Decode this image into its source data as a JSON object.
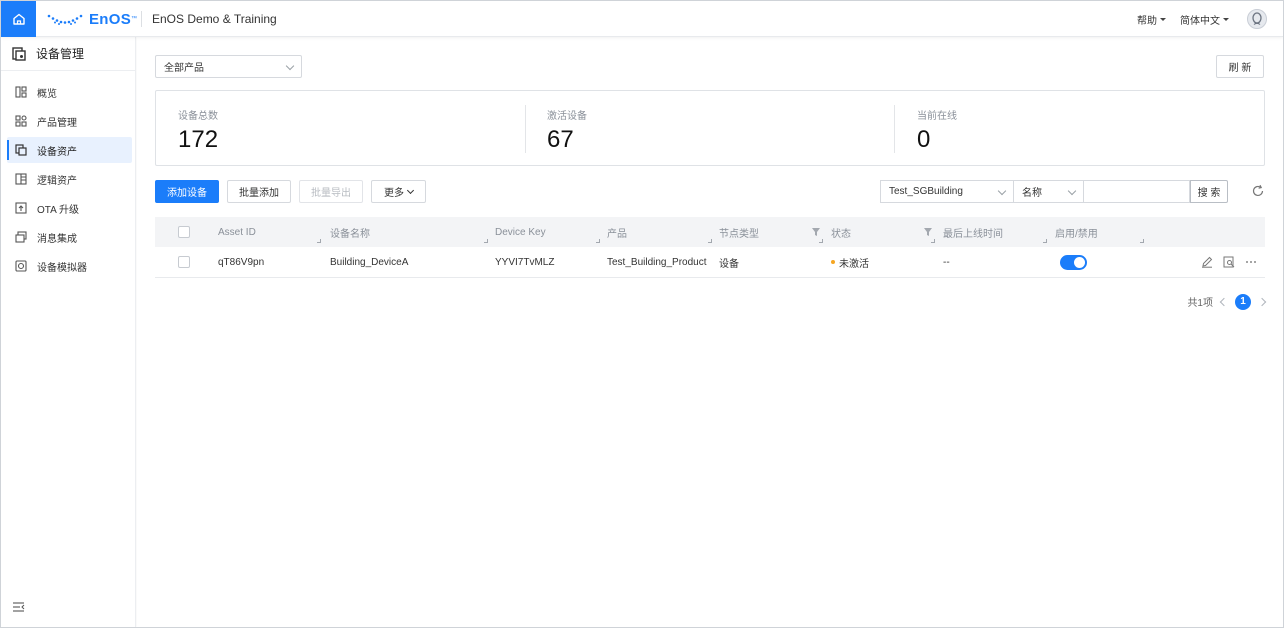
{
  "header": {
    "logo_text": "EnOS",
    "logo_tm": "™",
    "org_name": "EnOS Demo & Training",
    "help_label": "帮助",
    "language_label": "简体中文"
  },
  "sidebar": {
    "title": "设备管理",
    "items": [
      {
        "label": "概览",
        "icon": "dashboard-icon",
        "active": false
      },
      {
        "label": "产品管理",
        "icon": "product-grid-icon",
        "active": false
      },
      {
        "label": "设备资产",
        "icon": "device-asset-icon",
        "active": true
      },
      {
        "label": "逻辑资产",
        "icon": "logical-asset-icon",
        "active": false
      },
      {
        "label": "OTA 升级",
        "icon": "ota-upgrade-icon",
        "active": false
      },
      {
        "label": "消息集成",
        "icon": "message-integration-icon",
        "active": false
      },
      {
        "label": "设备模拟器",
        "icon": "device-simulator-icon",
        "active": false
      }
    ]
  },
  "filters": {
    "product_select": "全部产品",
    "refresh_label": "刷 新"
  },
  "stats": [
    {
      "label": "设备总数",
      "value": "172"
    },
    {
      "label": "激活设备",
      "value": "67"
    },
    {
      "label": "当前在线",
      "value": "0"
    }
  ],
  "toolbar": {
    "add_device": "添加设备",
    "batch_add": "批量添加",
    "batch_export": "批量导出",
    "more": "更多",
    "org_select": "Test_SGBuilding",
    "field_select": "名称",
    "search_placeholder": "",
    "search_label": "搜 索"
  },
  "table": {
    "columns": [
      "Asset ID",
      "设备名称",
      "Device Key",
      "产品",
      "节点类型",
      "状态",
      "最后上线时间",
      "启用/禁用"
    ],
    "rows": [
      {
        "asset_id": "qT86V9pn",
        "name": "Building_DeviceA",
        "device_key": "YYVI7TvMLZ",
        "product": "Test_Building_Product",
        "node_type": "设备",
        "status": "未激活",
        "last_online": "--",
        "enabled": true
      }
    ]
  },
  "pagination": {
    "total_label": "共1项",
    "current_page": "1"
  },
  "colors": {
    "accent": "#1b7dfa",
    "status_inactive": "#f5a623"
  }
}
